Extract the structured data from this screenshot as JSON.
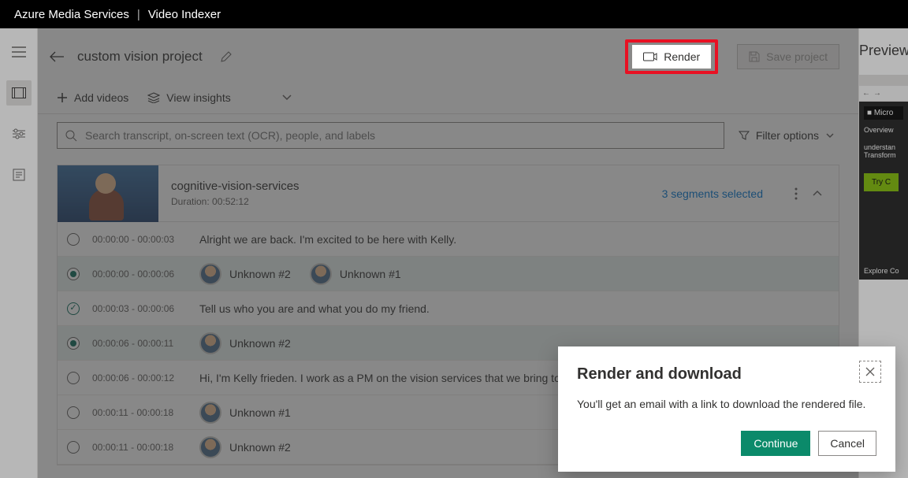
{
  "topbar": {
    "brand": "Azure Media Services",
    "section": "Video Indexer"
  },
  "project": {
    "name": "custom vision project"
  },
  "actions": {
    "render_label": "Render",
    "save_label": "Save project",
    "add_videos": "Add videos",
    "view_insights": "View insights",
    "filter_options": "Filter options"
  },
  "search": {
    "placeholder": "Search transcript, on-screen text (OCR), people, and labels"
  },
  "video": {
    "title": "cognitive-vision-services",
    "duration_label": "Duration: 00:52:12",
    "segments_selected": "3 segments selected"
  },
  "rows": [
    {
      "selected": false,
      "check": false,
      "time": "00:00:00 - 00:00:03",
      "type": "text",
      "text": "Alright we are back. I'm excited to be here with Kelly."
    },
    {
      "selected": true,
      "check": false,
      "time": "00:00:00 - 00:00:06",
      "type": "speakers",
      "speakers": [
        "Unknown #2",
        "Unknown #1"
      ]
    },
    {
      "selected": false,
      "check": true,
      "time": "00:00:03 - 00:00:06",
      "type": "text",
      "text": "Tell us who you are and what you do my friend."
    },
    {
      "selected": true,
      "check": false,
      "time": "00:00:06 - 00:00:11",
      "type": "speakers",
      "speakers": [
        "Unknown #2"
      ]
    },
    {
      "selected": false,
      "check": false,
      "time": "00:00:06 - 00:00:12",
      "type": "text",
      "text": "Hi, I'm Kelly frieden. I work as a PM on the vision services that we bring to you through cognitive services."
    },
    {
      "selected": false,
      "check": false,
      "time": "00:00:11 - 00:00:18",
      "type": "speakers",
      "speakers": [
        "Unknown #1"
      ]
    },
    {
      "selected": false,
      "check": false,
      "time": "00:00:11 - 00:00:18",
      "type": "speakers",
      "speakers": [
        "Unknown #2"
      ]
    }
  ],
  "preview": {
    "title": "Preview",
    "ms": "Micro",
    "overview": "Overview",
    "line1": "understan",
    "line2": "Transform",
    "try": "Try C",
    "explore": "Explore Co"
  },
  "modal": {
    "title": "Render and download",
    "body": "You'll get an email with a link to download the rendered file.",
    "continue": "Continue",
    "cancel": "Cancel"
  }
}
